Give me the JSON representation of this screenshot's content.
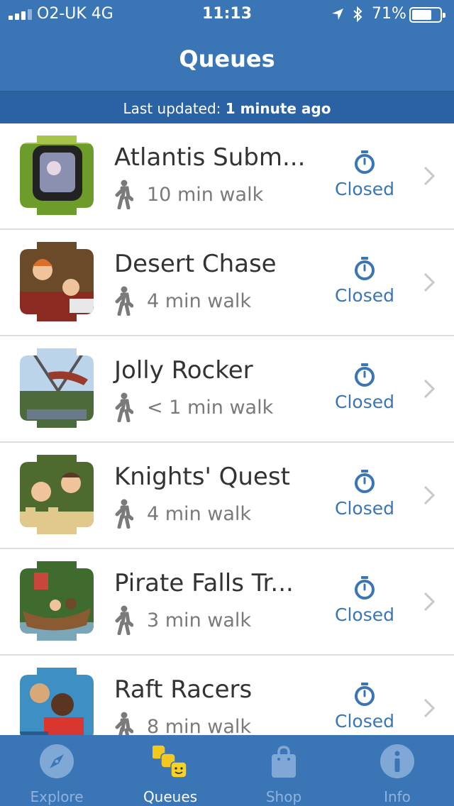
{
  "status_bar": {
    "carrier": "O2-UK   4G",
    "time": "11:13",
    "battery": "71%",
    "battery_level": 0.71
  },
  "nav": {
    "title": "Queues"
  },
  "updated": {
    "prefix": "Last updated:",
    "value": "1 minute ago"
  },
  "colors": {
    "brand_blue": "#3a75b6",
    "banner_blue": "#2b62a3",
    "status_blue": "#3a75b6"
  },
  "rides": [
    {
      "name": "Atlantis Subm...",
      "walk": "10 min walk",
      "status": "Closed"
    },
    {
      "name": "Desert Chase",
      "walk": "4 min walk",
      "status": "Closed"
    },
    {
      "name": "Jolly Rocker",
      "walk": "< 1 min walk",
      "status": "Closed"
    },
    {
      "name": "Knights' Quest",
      "walk": "4 min walk",
      "status": "Closed"
    },
    {
      "name": "Pirate Falls Tr...",
      "walk": "3 min walk",
      "status": "Closed"
    },
    {
      "name": "Raft Racers",
      "walk": "8 min walk",
      "status": "Closed"
    }
  ],
  "tabs": [
    {
      "label": "Explore",
      "icon": "compass-icon"
    },
    {
      "label": "Queues",
      "icon": "lego-heads-icon",
      "active": true
    },
    {
      "label": "Shop",
      "icon": "shopping-bag-icon"
    },
    {
      "label": "Info",
      "icon": "info-icon"
    }
  ]
}
